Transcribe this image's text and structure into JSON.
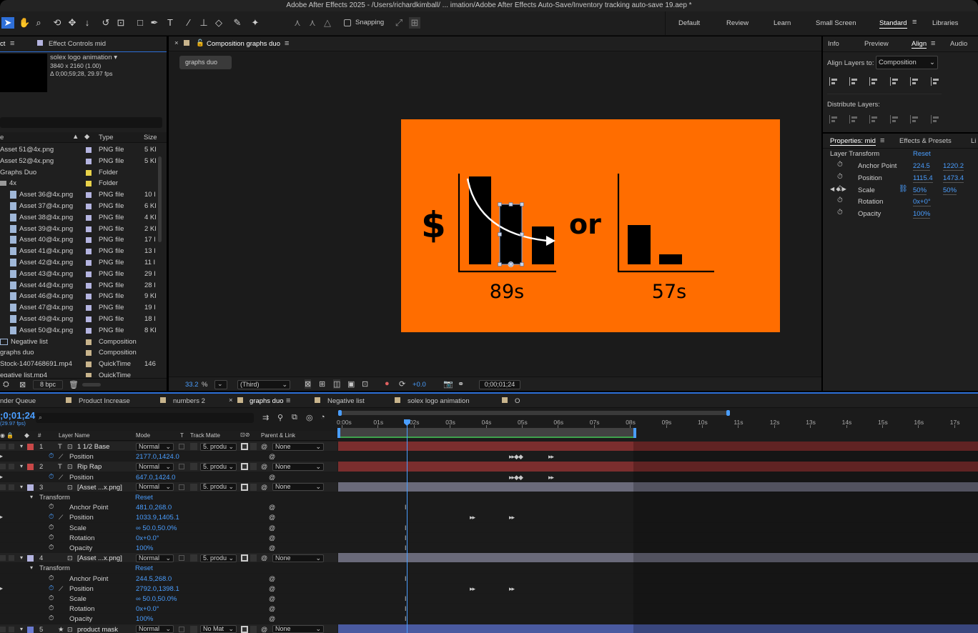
{
  "app": {
    "title": "Adobe After Effects 2025 - /Users/richardkimball/ ... imation/Adobe After Effects Auto-Save/Inventory tracking auto-save 19.aep *"
  },
  "toolbar": {
    "snapping_label": "Snapping",
    "workspaces": [
      "Default",
      "Review",
      "Learn",
      "Small Screen",
      "Standard",
      "Libraries"
    ]
  },
  "project": {
    "tab_project": "ct",
    "tab_effect_controls": "Effect Controls mid",
    "comp_name": "solex logo animation",
    "comp_resolution": "3840 x 2160 (1.00)",
    "comp_duration": "Δ 0;00;59;28, 29.97 fps",
    "col_name": "e",
    "col_type": "Type",
    "col_size": "Size",
    "items": [
      {
        "name": "Asset 51@4x.png",
        "type": "PNG file",
        "size": "5 KI",
        "color": "#b4b4e0",
        "indent": 0,
        "icon": "none"
      },
      {
        "name": "Asset 52@4x.png",
        "type": "PNG file",
        "size": "5 KI",
        "color": "#b4b4e0",
        "indent": 0,
        "icon": "none"
      },
      {
        "name": "Graphs Duo",
        "type": "Folder",
        "size": "",
        "color": "#e8d24a",
        "indent": 0,
        "icon": "none"
      },
      {
        "name": "4x",
        "type": "Folder",
        "size": "",
        "color": "#e8d24a",
        "indent": 1,
        "icon": "folder"
      },
      {
        "name": "Asset 36@4x.png",
        "type": "PNG file",
        "size": "10 I",
        "color": "#b4b4e0",
        "indent": 2,
        "icon": "file"
      },
      {
        "name": "Asset 37@4x.png",
        "type": "PNG file",
        "size": "6 KI",
        "color": "#b4b4e0",
        "indent": 2,
        "icon": "file"
      },
      {
        "name": "Asset 38@4x.png",
        "type": "PNG file",
        "size": "4 KI",
        "color": "#b4b4e0",
        "indent": 2,
        "icon": "file"
      },
      {
        "name": "Asset 39@4x.png",
        "type": "PNG file",
        "size": "2 KI",
        "color": "#b4b4e0",
        "indent": 2,
        "icon": "file"
      },
      {
        "name": "Asset 40@4x.png",
        "type": "PNG file",
        "size": "17 I",
        "color": "#b4b4e0",
        "indent": 2,
        "icon": "file"
      },
      {
        "name": "Asset 41@4x.png",
        "type": "PNG file",
        "size": "13 I",
        "color": "#b4b4e0",
        "indent": 2,
        "icon": "file"
      },
      {
        "name": "Asset 42@4x.png",
        "type": "PNG file",
        "size": "11 I",
        "color": "#b4b4e0",
        "indent": 2,
        "icon": "file"
      },
      {
        "name": "Asset 43@4x.png",
        "type": "PNG file",
        "size": "29 I",
        "color": "#b4b4e0",
        "indent": 2,
        "icon": "file"
      },
      {
        "name": "Asset 44@4x.png",
        "type": "PNG file",
        "size": "28 I",
        "color": "#b4b4e0",
        "indent": 2,
        "icon": "file"
      },
      {
        "name": "Asset 46@4x.png",
        "type": "PNG file",
        "size": "9 KI",
        "color": "#b4b4e0",
        "indent": 2,
        "icon": "file"
      },
      {
        "name": "Asset 47@4x.png",
        "type": "PNG file",
        "size": "19 I",
        "color": "#b4b4e0",
        "indent": 2,
        "icon": "file"
      },
      {
        "name": "Asset 49@4x.png",
        "type": "PNG file",
        "size": "18 I",
        "color": "#b4b4e0",
        "indent": 2,
        "icon": "file"
      },
      {
        "name": "Asset 50@4x.png",
        "type": "PNG file",
        "size": "8 KI",
        "color": "#b4b4e0",
        "indent": 2,
        "icon": "file"
      },
      {
        "name": "Negative list",
        "type": "Composition",
        "size": "",
        "color": "#c8b48c",
        "indent": 1,
        "icon": "comp"
      },
      {
        "name": "graphs duo",
        "type": "Composition",
        "size": "",
        "color": "#c8b48c",
        "indent": 0,
        "icon": "none"
      },
      {
        "name": "Stock-1407468691.mp4",
        "type": "QuickTime",
        "size": "146",
        "color": "#c8b48c",
        "indent": 0,
        "icon": "none"
      },
      {
        "name": "egative list.mp4",
        "type": "QuickTime",
        "size": "",
        "color": "#c8b48c",
        "indent": 0,
        "icon": "none"
      }
    ],
    "bpc": "8 bpc"
  },
  "composition": {
    "tab_label": "Composition graphs duo",
    "breadcrumb": "graphs duo",
    "zoom": "33.2",
    "zoom_unit": "%",
    "resolution": "(Third)",
    "exposure": "+0.0",
    "timecode": "0;00;01;24",
    "canvas": {
      "bg": "#ff6d00",
      "dollar": "$",
      "or": "or",
      "label_left": "89s",
      "label_right": "57s"
    }
  },
  "align": {
    "tabs": [
      "Info",
      "Preview",
      "Align",
      "Audio"
    ],
    "align_to_label": "Align Layers to:",
    "align_to_value": "Composition",
    "distribute_label": "Distribute Layers:"
  },
  "properties": {
    "tab": "Properties: mid",
    "tab2": "Effects & Presets",
    "tab3": "Li",
    "section": "Layer Transform",
    "reset": "Reset",
    "rows": [
      {
        "label": "Anchor Point",
        "v1": "224.5",
        "v2": "1220.2"
      },
      {
        "label": "Position",
        "v1": "1115.4",
        "v2": "1473.4"
      },
      {
        "label": "Scale",
        "v1": "50%",
        "v2": "50%"
      },
      {
        "label": "Rotation",
        "v1": "0x+0°",
        "v2": ""
      },
      {
        "label": "Opacity",
        "v1": "100%",
        "v2": ""
      }
    ]
  },
  "timeline": {
    "tabs": [
      {
        "label": "nder Queue",
        "color": ""
      },
      {
        "label": "Product Increase",
        "color": "#c8b48c"
      },
      {
        "label": "numbers 2",
        "color": "#c8b48c"
      },
      {
        "label": "graphs duo",
        "color": "#c8b48c"
      },
      {
        "label": "Negative list",
        "color": "#c8b48c"
      },
      {
        "label": "solex logo animation",
        "color": "#c8b48c"
      },
      {
        "label": "O",
        "color": "#c8b48c"
      }
    ],
    "timecode": ";0;01;24",
    "fps": "(29.97 fps)",
    "search_placeholder": "",
    "col_hash": "#",
    "col_layer_name": "Layer Name",
    "col_mode": "Mode",
    "col_t": "T",
    "col_track_matte": "Track Matte",
    "col_parent": "Parent & Link",
    "ruler": [
      "0:00s",
      "01s",
      "02s",
      "03s",
      "04s",
      "05s",
      "06s",
      "07s",
      "08s",
      "09s",
      "10s",
      "11s",
      "12s",
      "13s",
      "14s",
      "15s",
      "16s",
      "17s"
    ],
    "current_time_s": 1.8
  }
}
